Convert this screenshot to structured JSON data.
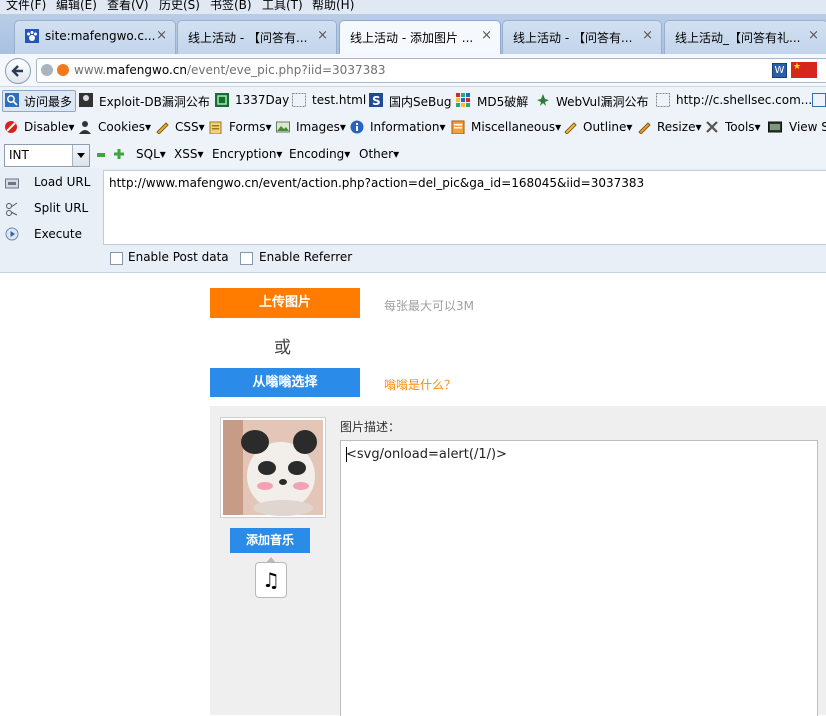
{
  "menu": [
    "文件(F)",
    "编辑(E)",
    "查看(V)",
    "历史(S)",
    "书签(B)",
    "工具(T)",
    "帮助(H)"
  ],
  "tabs": [
    {
      "label": "site:mafengwo.c...",
      "close": "×"
    },
    {
      "label": "线上活动 - 【问答有...",
      "close": "×"
    },
    {
      "label": "线上活动 - 添加图片 ...",
      "close": "×"
    },
    {
      "label": "线上活动 - 【问答有...",
      "close": "×"
    },
    {
      "label": "线上活动_【问答有礼...",
      "close": "×"
    }
  ],
  "address": {
    "prefix": "www.",
    "domain": "mafengwo.cn",
    "path": "/event/eve_pic.php?iid=3037383",
    "w_label": "W"
  },
  "bookmarks": [
    "访问最多",
    "Exploit-DB漏洞公布",
    "1337Day",
    "test.html",
    "国内SeBug",
    "MD5破解",
    "WebVul漏洞公布",
    "http://c.shellsec.com..."
  ],
  "webdev": [
    "Disable▾",
    "Cookies▾",
    "CSS▾",
    "Forms▾",
    "Images▾",
    "Information▾",
    "Miscellaneous▾",
    "Outline▾",
    "Resize▾",
    "Tools▾",
    "View S"
  ],
  "hackbar": {
    "select_value": "INT",
    "menus": [
      "SQL▾",
      "XSS▾",
      "Encryption▾",
      "Encoding▾",
      "Other▾"
    ],
    "load_url": "Load URL",
    "split_url": "Split URL",
    "execute": "Execute",
    "url_value": "http://www.mafengwo.cn/event/action.php?action=del_pic&ga_id=168045&iid=3037383",
    "enable_post": "Enable Post data",
    "enable_referrer": "Enable Referrer"
  },
  "page": {
    "upload_button": "上传图片",
    "upload_hint": "每张最大可以3M",
    "or_text": "或",
    "choose_button": "从嗡嗡选择",
    "what_link": "嗡嗡是什么？",
    "add_music_button": "添加音乐",
    "music_icon_glyph": "♫",
    "desc_label": "图片描述：",
    "desc_value": "<svg/onload=alert(/1/)>"
  }
}
